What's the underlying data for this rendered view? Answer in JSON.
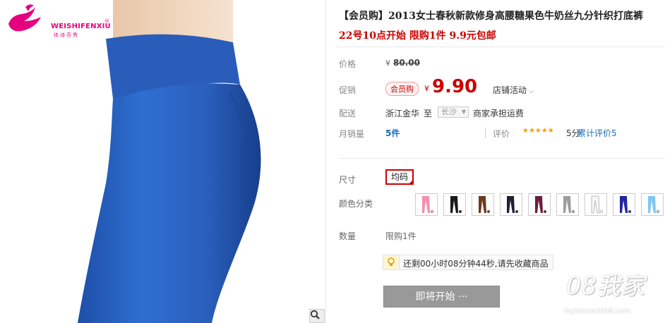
{
  "brand": {
    "name": "WEISHIFENXIU",
    "registered": "®",
    "tagline": "纬诗芬秀"
  },
  "product": {
    "title": "【会员购】2013女士春秋新款修身高腰糖果色牛奶丝九分针织打底裤",
    "subtitle": "22号10点开始 限购1件 9.9元包邮"
  },
  "price": {
    "label": "价格",
    "currency": "¥",
    "original": "80.00"
  },
  "promo": {
    "label": "促销",
    "badge": "会员购",
    "currency": "¥",
    "price": "9.90",
    "store_activity": "店铺活动"
  },
  "shipping": {
    "label": "配送",
    "from": "浙江金华",
    "to_word": "至",
    "destination": "长沙",
    "note": "商家承担运费"
  },
  "sales": {
    "label": "月销量",
    "count": "5件"
  },
  "rating": {
    "label": "评价",
    "stars": "★★★★★",
    "score_text": "5分",
    "review_label": "累计评价",
    "review_count": "5"
  },
  "size": {
    "label": "尺寸",
    "option": "均码"
  },
  "color": {
    "label": "颜色分类",
    "swatch_colors": [
      "#f48fb1",
      "#1a1a1a",
      "#6d3a1e",
      "#1f2233",
      "#6b1e3a",
      "#9e9e9e",
      "#f5f5f5",
      "#22279e",
      "#7ec8ef",
      "#f08a4b"
    ]
  },
  "quantity": {
    "label": "数量",
    "limit": "限购1件"
  },
  "tip": {
    "text": "还剩00小时08分钟44秒,请先收藏商品"
  },
  "button": {
    "label": "即将开始 ···"
  },
  "watermark": {
    "number": "08我家",
    "url": "myhome2008.com"
  }
}
